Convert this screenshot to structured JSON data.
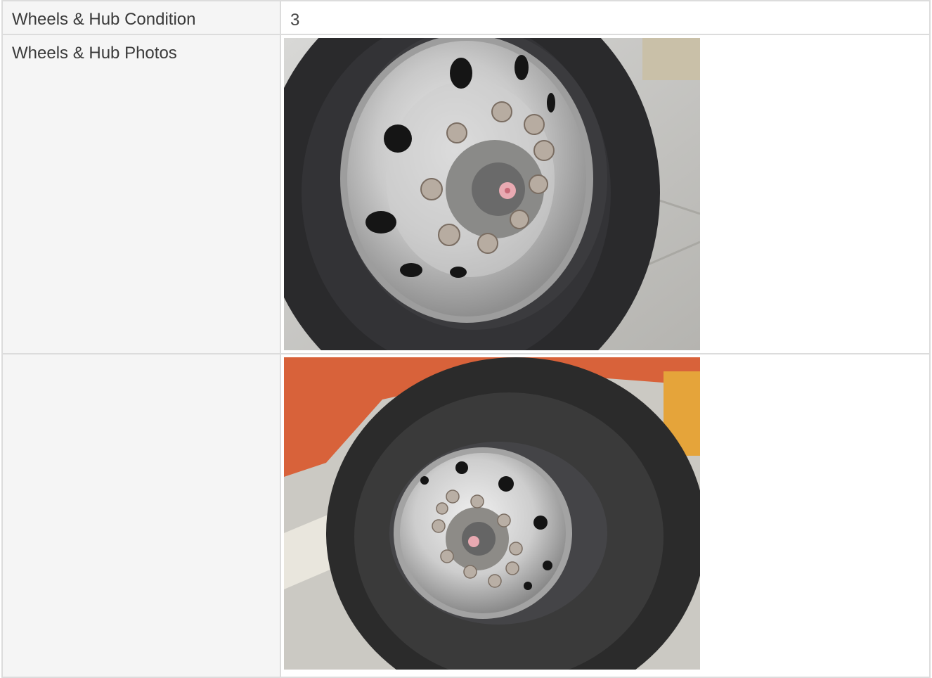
{
  "rows": [
    {
      "label": "Wheels & Hub Condition",
      "value": "3"
    },
    {
      "label": "Wheels & Hub Photos",
      "photo": "wheel-hub-photo-closeup"
    },
    {
      "label": "",
      "photo": "wheel-hub-photo-wide"
    }
  ],
  "colors": {
    "label_bg": "#f5f5f5",
    "border": "#dcdcdc",
    "text": "#3a3a3a"
  }
}
